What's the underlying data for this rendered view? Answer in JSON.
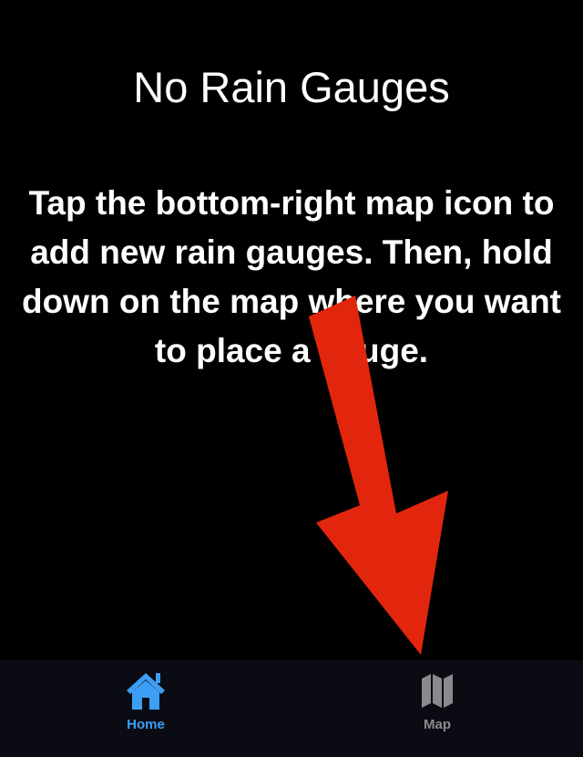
{
  "empty_state": {
    "title": "No Rain Gauges",
    "message": "Tap the bottom-right map icon to add new rain gauges. Then, hold down on the map where you want to place a gauge."
  },
  "annotation": {
    "icon": "arrow-down-icon",
    "color": "#e2260d"
  },
  "tab_bar": {
    "background": "#0b0c13",
    "tabs": [
      {
        "label": "Home",
        "icon": "house-icon",
        "selected": true,
        "color": "#3c9ff5"
      },
      {
        "label": "Map",
        "icon": "map-icon",
        "selected": false,
        "color": "#8a8a8e"
      }
    ]
  }
}
